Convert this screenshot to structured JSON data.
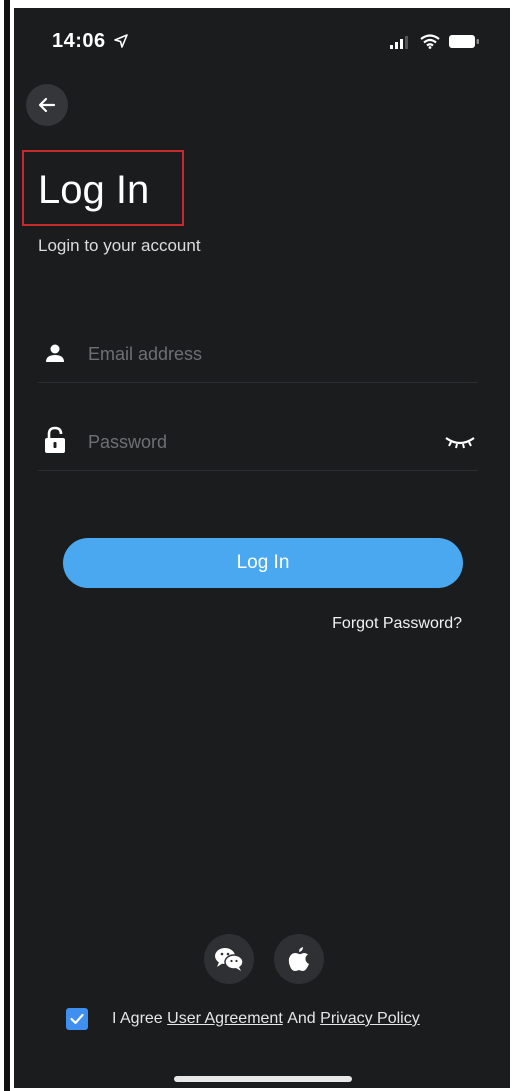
{
  "status": {
    "time": "14:06"
  },
  "icons": {
    "back": "arrow-left-icon",
    "location": "location-arrow-icon",
    "signal": "signal-icon",
    "wifi": "wifi-icon",
    "battery": "battery-icon",
    "user": "user-icon",
    "lock": "lock-icon",
    "eye": "eye-closed-icon",
    "wechat": "wechat-icon",
    "apple": "apple-icon"
  },
  "header": {
    "title": "Log In",
    "subtitle": "Login to your account"
  },
  "form": {
    "email": {
      "placeholder": "Email address",
      "value": ""
    },
    "password": {
      "placeholder": "Password",
      "value": ""
    },
    "login_label": "Log In",
    "forgot_label": "Forgot Password?"
  },
  "agreement": {
    "checked": true,
    "prefix": "I Agree",
    "user_agreement": "User Agreement",
    "and": "And",
    "privacy_policy": "Privacy Policy"
  },
  "colors": {
    "background": "#1b1c1e",
    "accent": "#4aa8f0",
    "checkbox": "#3f8ff0",
    "highlight": "#c62b2b"
  }
}
